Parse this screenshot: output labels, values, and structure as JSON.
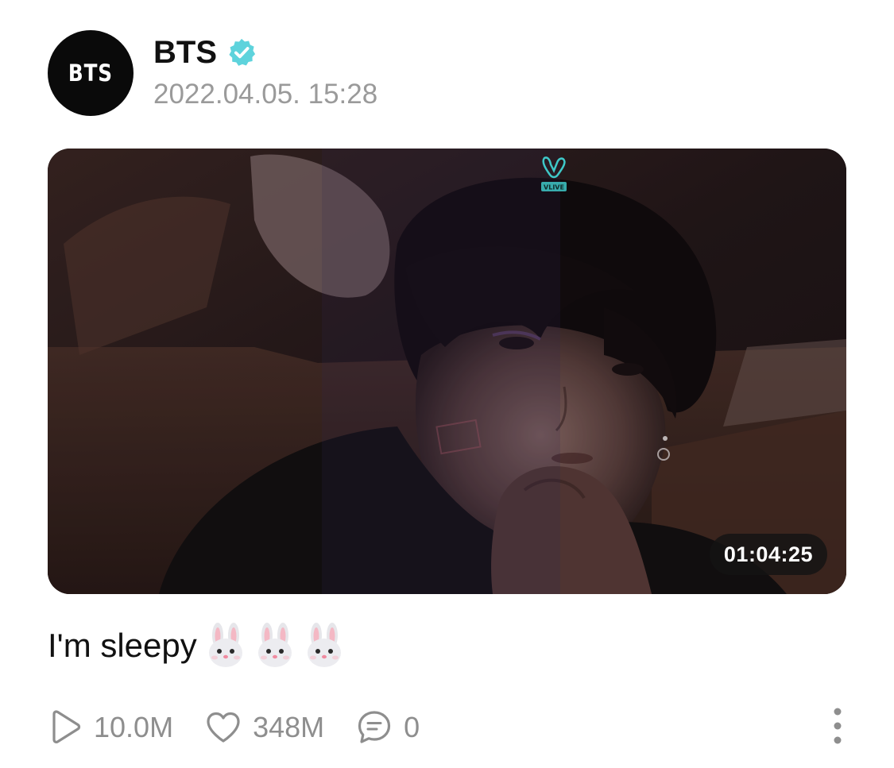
{
  "post": {
    "author": {
      "avatar_text": "BTS",
      "name": "BTS",
      "verified": true,
      "verified_color": "#5ed3dc"
    },
    "timestamp": "2022.04.05. 15:28",
    "video": {
      "duration": "01:04:25",
      "logo_text": "VLIVE",
      "logo_color": "#3ec8c8"
    },
    "caption": {
      "text": "I'm sleepy",
      "emojis": [
        "rabbit-face-emoji",
        "rabbit-face-emoji",
        "rabbit-face-emoji"
      ]
    },
    "stats": {
      "plays": "10.0M",
      "likes": "348M",
      "comments": "0"
    },
    "icons": {
      "plays": "play-icon",
      "likes": "heart-icon",
      "comments": "comment-icon",
      "more": "more-vertical-icon"
    },
    "colors": {
      "text_primary": "#111111",
      "text_secondary": "#9a9a9a",
      "icon_gray": "#8e8e8e"
    }
  }
}
